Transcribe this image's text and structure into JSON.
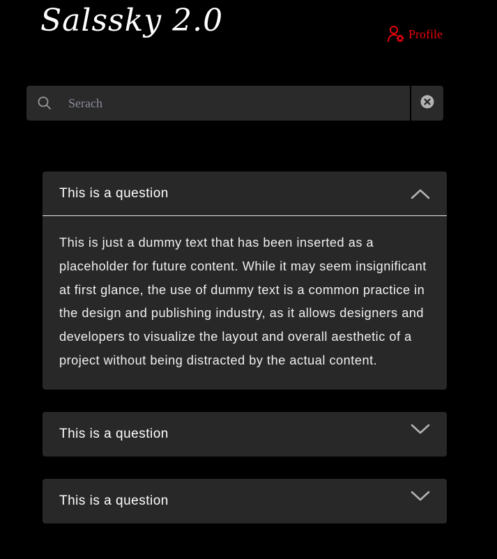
{
  "header": {
    "logo_text": "Salssky 2.0",
    "profile_label": "Profile",
    "profile_icon": "user-gear-icon"
  },
  "search": {
    "placeholder": "Serach",
    "value": "",
    "search_icon": "search-icon",
    "clear_icon": "close-circle-icon"
  },
  "faq": {
    "items": [
      {
        "question": "This is a question",
        "answer": "This is just a dummy text that has been inserted as a placeholder for future content. While it may seem insignificant at first glance, the use of dummy text is a common practice in the design and publishing industry, as it allows designers and developers to visualize the layout and overall aesthetic of a project without being distracted by the actual content.",
        "expanded": true,
        "toggle_icon": "chevron-up-icon"
      },
      {
        "question": "This is a question",
        "answer": "",
        "expanded": false,
        "toggle_icon": "chevron-down-icon"
      },
      {
        "question": "This is a question",
        "answer": "",
        "expanded": false,
        "toggle_icon": "chevron-down-icon"
      }
    ]
  },
  "colors": {
    "background": "#000000",
    "panel": "#282828",
    "accent_red": "#e8000d",
    "text": "#ffffff",
    "muted": "#8a8f99"
  }
}
